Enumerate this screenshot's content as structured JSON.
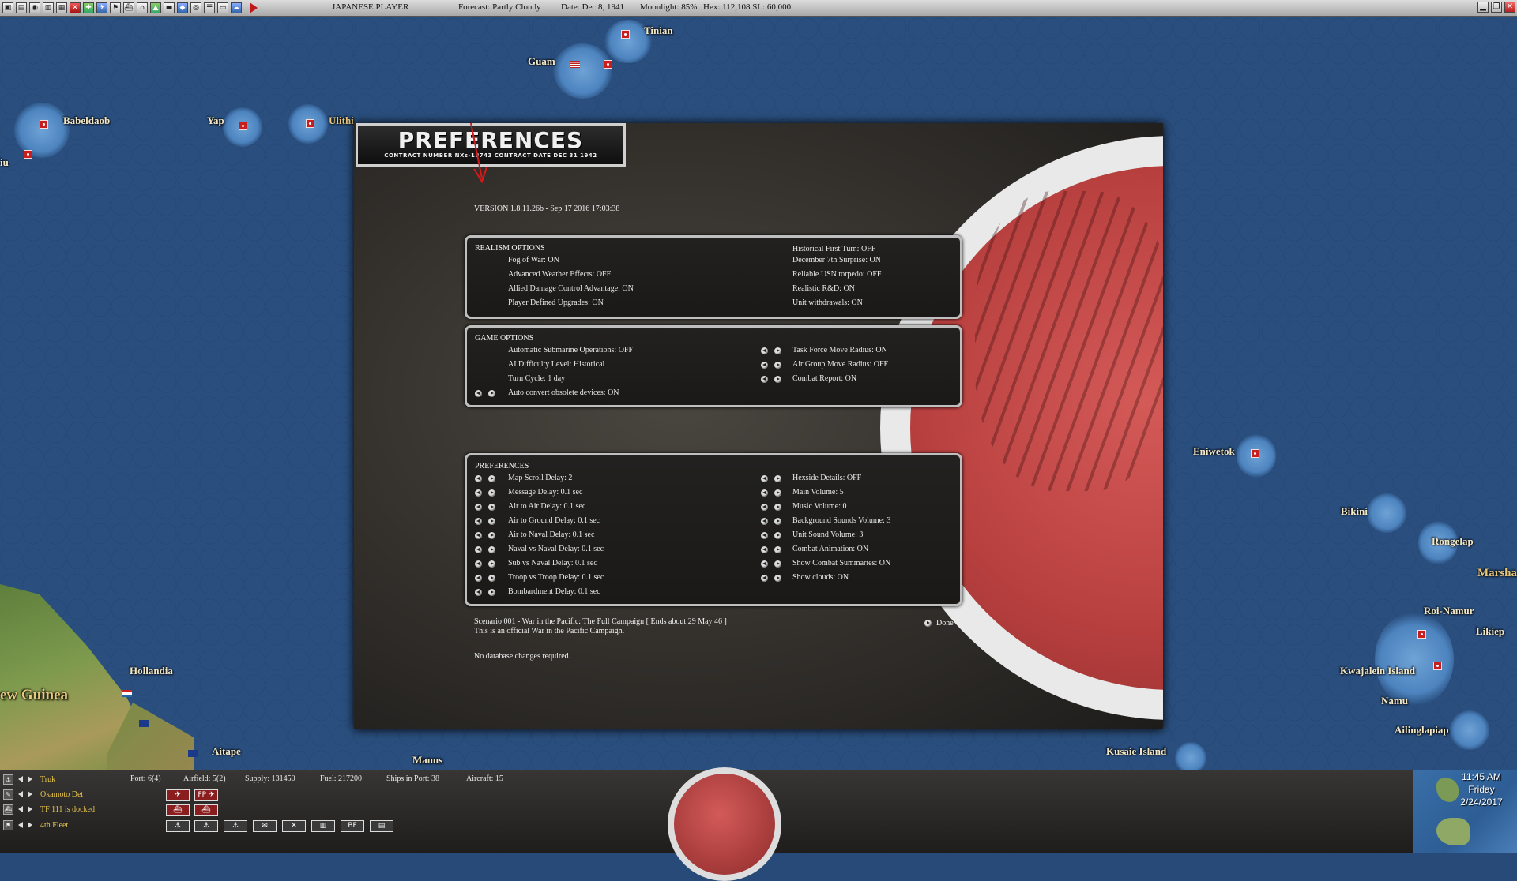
{
  "toolbar": {
    "player": "JAPANESE PLAYER",
    "forecast": "Forecast: Partly Cloudy",
    "date": "Date: Dec 8, 1941",
    "moonlight": "Moonlight: 85%",
    "hex": "Hex: 112,108  SL: 60,000",
    "icons": [
      "save-icon",
      "load-icon",
      "game-icon",
      "files-icon",
      "database-icon",
      "flag-icon",
      "map-icon",
      "plane-icon",
      "aircraft-icon",
      "ship-icon",
      "base-icon",
      "ground-icon",
      "unit-icon",
      "info-icon",
      "globe-icon",
      "list-icon",
      "report-icon",
      "ledger-icon",
      "graph-icon",
      "cloud-icon"
    ],
    "play_icon": "end-turn-icon"
  },
  "map": {
    "labels": [
      "Tinian",
      "Guam",
      "Babeldaob",
      "Yap",
      "Ulithi",
      "iu",
      "Eniwetok",
      "Bikini",
      "Rongelap",
      "Marsha",
      "Roi-Namur",
      "Likiep",
      "Kwajalein Island",
      "Namu",
      "Ailinglapiap",
      "Kusaie Island",
      "Hollandia",
      "ew Guinea",
      "Aitape",
      "Manus"
    ]
  },
  "dialog": {
    "title": "PREFERENCES",
    "contract": "CONTRACT NUMBER  NXs-18743   CONTRACT DATE  DEC 31 1942",
    "version": "VERSION 1.8.11.26b - Sep 17 2016 17:03:38",
    "realism": {
      "heading": "REALISM OPTIONS",
      "left": [
        "Fog of War: ON",
        "Advanced Weather Effects: OFF",
        "Allied Damage Control Advantage: ON",
        "Player Defined Upgrades: ON"
      ],
      "right": [
        "Historical First Turn: OFF",
        "December 7th Surprise: ON",
        "Reliable USN torpedo: OFF",
        "Realistic R&D: ON",
        "Unit withdrawals: ON"
      ]
    },
    "game": {
      "heading": "GAME OPTIONS",
      "left": [
        "Automatic Submarine Operations: OFF",
        "AI Difficulty Level: Historical",
        "Turn Cycle: 1 day",
        "Auto convert obsolete devices: ON"
      ],
      "right": [
        "Task Force Move Radius: ON",
        "Air Group Move Radius: OFF",
        "Combat Report: ON"
      ]
    },
    "prefs": {
      "heading": "PREFERENCES",
      "left": [
        "Map Scroll Delay: 2",
        "Message Delay: 0.1 sec",
        "Air to Air Delay: 0.1 sec",
        "Air to Ground Delay: 0.1 sec",
        "Air to Naval Delay: 0.1 sec",
        "Naval vs Naval Delay: 0.1 sec",
        "Sub vs Naval Delay: 0.1 sec",
        "Troop vs Troop Delay: 0.1 sec",
        "Bombardment Delay: 0.1 sec"
      ],
      "right": [
        "Hexside Details: OFF",
        "Main Volume: 5",
        "Music Volume: 0",
        "Background Sounds Volume: 3",
        "Unit Sound Volume: 3",
        "Combat Animation: ON",
        "Show Combat Summaries: ON",
        "Show clouds: ON"
      ]
    },
    "scenario_line1": "Scenario 001 - War in the Pacific: The Full Campaign  [ Ends about 29 May 46 ]",
    "scenario_line2": "This is an official War in the Pacific Campaign.",
    "db_note": "No database changes required.",
    "done_label": "Done"
  },
  "bottom": {
    "rows": [
      {
        "icon": "anchor-icon",
        "label": "Truk"
      },
      {
        "icon": "soldier-icon",
        "label": "Okamoto Det"
      },
      {
        "icon": "ship-icon",
        "label": "TF 111 is docked"
      },
      {
        "icon": "flag-icon",
        "label": "4th Fleet"
      }
    ],
    "port": "Port: 6(4)",
    "airfield": "Airfield: 5(2)",
    "supply": "Supply: 131450",
    "fuel": "Fuel: 217200",
    "ships": "Ships in Port: 38",
    "aircraft": "Aircraft: 15",
    "unit_buttons_row1": [
      "✈",
      "FP ✈"
    ],
    "unit_buttons_row2": [
      "⛴",
      "⛴"
    ],
    "unit_buttons_row3": [
      "⚓",
      "⚓",
      "⚓",
      "✉",
      "✕",
      "▥",
      "BF",
      "▤"
    ],
    "clock_time": "11:45 AM",
    "clock_day": "Friday",
    "clock_date": "2/24/2017"
  }
}
